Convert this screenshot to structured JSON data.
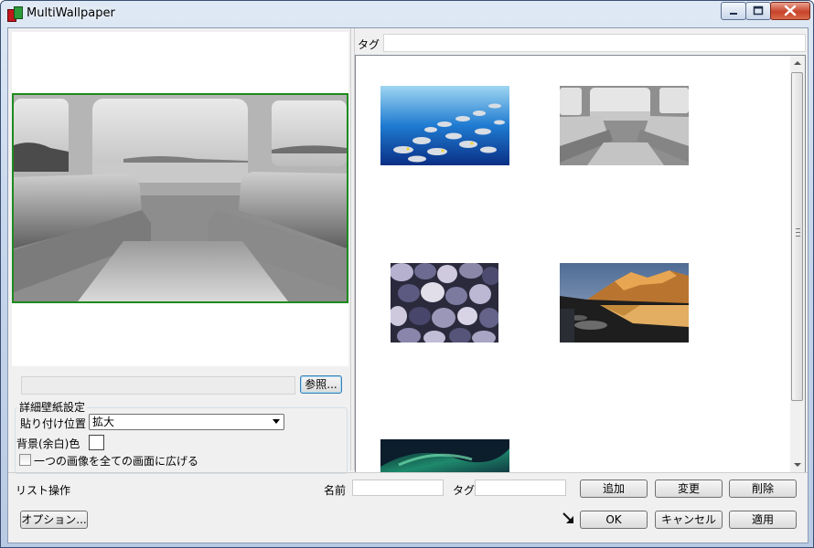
{
  "window": {
    "title": "MultiWallpaper"
  },
  "left_panel": {
    "browse_label": "参照...",
    "group_title": "詳細壁紙設定",
    "placement_label": "貼り付け位置",
    "placement_value": "拡大",
    "bg_color_label": "背景(余白)色",
    "span_checkbox_label": "一つの画像を全ての画面に広げる",
    "span_checked": false,
    "bg_color": "#ffffff"
  },
  "right_panel": {
    "tag_label": "タグ",
    "tag_value": ""
  },
  "gallery": {
    "thumbnails": [
      {
        "name": "fish-school",
        "icon": "fish-school-thumbnail"
      },
      {
        "name": "train-interior",
        "icon": "train-interior-thumbnail"
      },
      {
        "name": "pebbles",
        "icon": "pebbles-thumbnail"
      },
      {
        "name": "mountain-lake",
        "icon": "mountain-lake-thumbnail"
      },
      {
        "name": "aurora",
        "icon": "aurora-thumbnail"
      }
    ]
  },
  "list_ops": {
    "label": "リスト操作",
    "name_label": "名前",
    "name_value": "",
    "tag_label": "タグ",
    "tag_value": "",
    "add_label": "追加",
    "change_label": "変更",
    "delete_label": "削除"
  },
  "footer": {
    "options_label": "オプション...",
    "ok_label": "OK",
    "cancel_label": "キャンセル",
    "apply_label": "適用"
  },
  "colors": {
    "selection_border": "#1d8a1d",
    "close_button": "#c7432a"
  }
}
